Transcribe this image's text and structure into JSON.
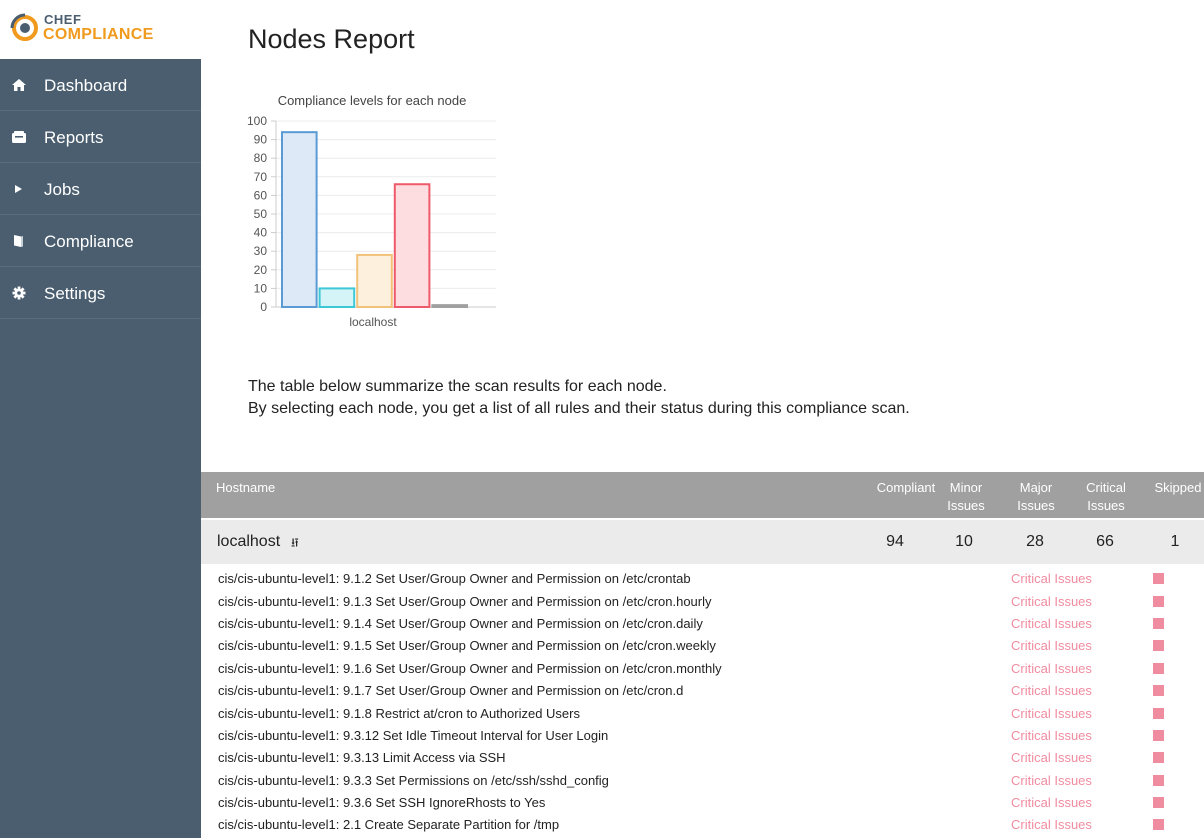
{
  "brand": {
    "line1": "CHEF",
    "line2": "COMPLIANCE",
    "accent": "#f09a1e",
    "sidebar_bg": "#4a5e70"
  },
  "sidebar": {
    "items": [
      {
        "label": "Dashboard",
        "icon": "home-icon"
      },
      {
        "label": "Reports",
        "icon": "inbox-icon"
      },
      {
        "label": "Jobs",
        "icon": "play-icon"
      },
      {
        "label": "Compliance",
        "icon": "book-icon"
      },
      {
        "label": "Settings",
        "icon": "gear-icon"
      }
    ]
  },
  "page": {
    "title": "Nodes Report",
    "intro_line1": "The table below summarize the scan results for each node.",
    "intro_line2": "By selecting each node, you get a list of all rules and their status during this compliance scan."
  },
  "chart_data": {
    "type": "bar",
    "title": "Compliance levels for each node",
    "categories": [
      "localhost"
    ],
    "series": [
      {
        "values": [
          94
        ],
        "color": "#5b9bd5",
        "fill": "#dde9f6"
      },
      {
        "values": [
          10
        ],
        "color": "#3dc8d8",
        "fill": "#d4f4f7"
      },
      {
        "values": [
          28
        ],
        "color": "#f1c27a",
        "fill": "#fdf0dc"
      },
      {
        "values": [
          66
        ],
        "color": "#ee5a6a",
        "fill": "#fddde0"
      },
      {
        "values": [
          1
        ],
        "color": "#a0a0a0",
        "fill": "#e6e6e6"
      }
    ],
    "ylim": [
      0,
      100
    ],
    "yticks": [
      0,
      10,
      20,
      30,
      40,
      50,
      60,
      70,
      80,
      90,
      100
    ],
    "grid": true
  },
  "table": {
    "headers": {
      "hostname": "Hostname",
      "compliant": "Compliant",
      "minor_1": "Minor",
      "minor_2": "Issues",
      "major_1": "Major",
      "major_2": "Issues",
      "critical_1": "Critical",
      "critical_2": "Issues",
      "skipped": "Skipped"
    },
    "node": {
      "hostname": "localhost",
      "compliant": "94",
      "minor": "10",
      "major": "28",
      "critical": "66",
      "skipped": "1"
    },
    "rules": [
      {
        "name": "cis/cis-ubuntu-level1: 9.1.2 Set User/Group Owner and Permission on /etc/crontab",
        "status": "Critical Issues"
      },
      {
        "name": "cis/cis-ubuntu-level1: 9.1.3 Set User/Group Owner and Permission on /etc/cron.hourly",
        "status": "Critical Issues"
      },
      {
        "name": "cis/cis-ubuntu-level1: 9.1.4 Set User/Group Owner and Permission on /etc/cron.daily",
        "status": "Critical Issues"
      },
      {
        "name": "cis/cis-ubuntu-level1: 9.1.5 Set User/Group Owner and Permission on /etc/cron.weekly",
        "status": "Critical Issues"
      },
      {
        "name": "cis/cis-ubuntu-level1: 9.1.6 Set User/Group Owner and Permission on /etc/cron.monthly",
        "status": "Critical Issues"
      },
      {
        "name": "cis/cis-ubuntu-level1: 9.1.7 Set User/Group Owner and Permission on /etc/cron.d",
        "status": "Critical Issues"
      },
      {
        "name": "cis/cis-ubuntu-level1: 9.1.8 Restrict at/cron to Authorized Users",
        "status": "Critical Issues"
      },
      {
        "name": "cis/cis-ubuntu-level1: 9.3.12 Set Idle Timeout Interval for User Login",
        "status": "Critical Issues"
      },
      {
        "name": "cis/cis-ubuntu-level1: 9.3.13 Limit Access via SSH",
        "status": "Critical Issues"
      },
      {
        "name": "cis/cis-ubuntu-level1: 9.3.3 Set Permissions on /etc/ssh/sshd_config",
        "status": "Critical Issues"
      },
      {
        "name": "cis/cis-ubuntu-level1: 9.3.6 Set SSH IgnoreRhosts to Yes",
        "status": "Critical Issues"
      },
      {
        "name": "cis/cis-ubuntu-level1: 2.1 Create Separate Partition for /tmp",
        "status": "Critical Issues"
      }
    ]
  }
}
